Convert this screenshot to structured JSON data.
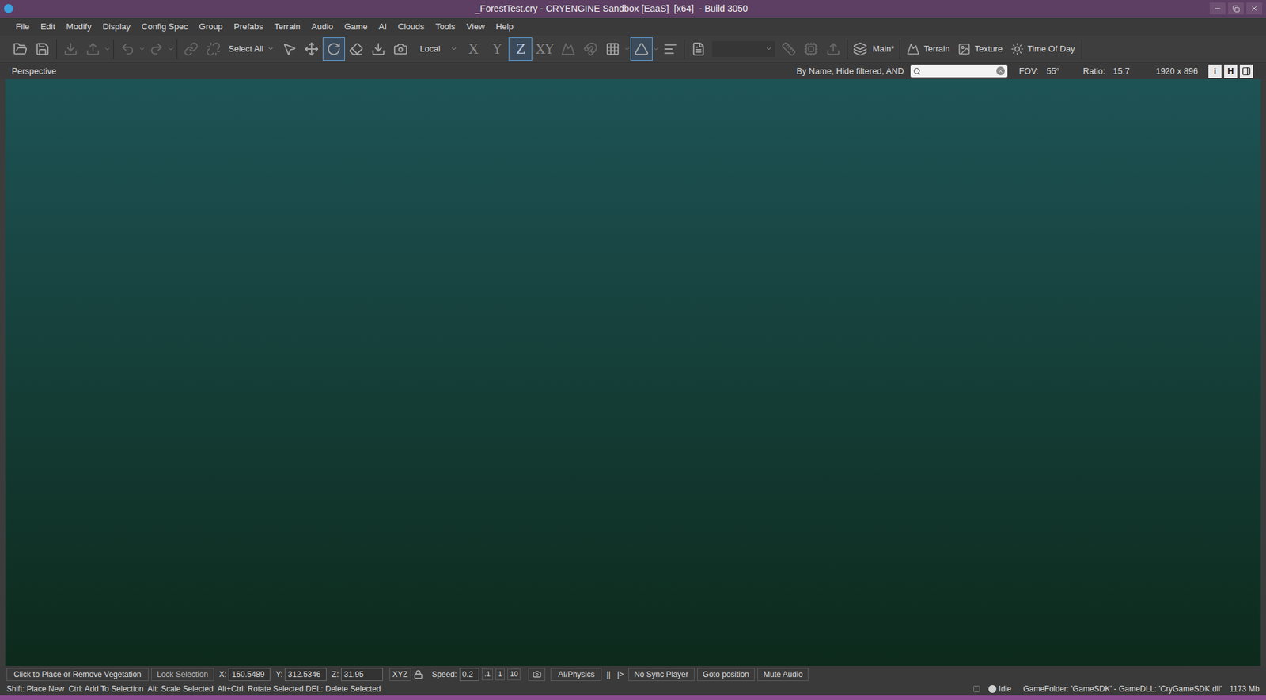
{
  "window": {
    "title": "_ForestTest.cry - CRYENGINE Sandbox [EaaS]  [x64]  - Build 3050"
  },
  "menu": [
    "File",
    "Edit",
    "Modify",
    "Display",
    "Config Spec",
    "Group",
    "Prefabs",
    "Terrain",
    "Audio",
    "Game",
    "AI",
    "Clouds",
    "Tools",
    "View",
    "Help"
  ],
  "toolbar": {
    "selection_filter": "Select All",
    "tools": [
      {
        "kind": "select",
        "selected": false
      },
      {
        "kind": "move",
        "selected": false
      },
      {
        "kind": "rotate",
        "selected": true
      },
      {
        "kind": "scale",
        "selected": false
      },
      {
        "kind": "drop",
        "selected": false
      },
      {
        "kind": "camera",
        "selected": false
      }
    ],
    "coord_system": "Local",
    "axes": [
      {
        "label": "X",
        "selected": false
      },
      {
        "label": "Y",
        "selected": false
      },
      {
        "label": "Z",
        "selected": true
      },
      {
        "label": "XY",
        "selected": false
      }
    ],
    "snap_grid": false,
    "snap_angle": true,
    "layer": "Main*",
    "buttons": [
      "Terrain",
      "Texture",
      "Time Of Day"
    ]
  },
  "viewport_header": {
    "view": "Perspective",
    "filter": "By Name, Hide filtered, AND",
    "search": {
      "placeholder": ""
    },
    "fov_label": "FOV:",
    "fov": "55°",
    "ratio_label": "Ratio:",
    "ratio": "15:7",
    "resolution": "1920 x 896",
    "buttons": [
      "i",
      "H"
    ]
  },
  "status_bar": {
    "hint": "Click to Place or Remove Vegetation",
    "lock": "Lock Selection",
    "coords": [
      {
        "label": "X:",
        "value": "160.5489"
      },
      {
        "label": "Y:",
        "value": "312.5346"
      },
      {
        "label": "Z:",
        "value": "31.95"
      }
    ],
    "axis_lock": "XYZ",
    "speed_label": "Speed:",
    "speed": "0.2",
    "speed_presets": [
      ".1",
      "1",
      "10"
    ],
    "ai_physics": "AI/Physics",
    "playback": [
      "||",
      "|>"
    ],
    "buttons": [
      "No Sync Player",
      "Goto position",
      "Mute Audio"
    ]
  },
  "info_bar": {
    "shortcuts": "Shift: Place New  Ctrl: Add To Selection  Alt: Scale Selected  Alt+Ctrl: Rotate Selected DEL: Delete Selected",
    "state": "Idle",
    "game_folder": "GameFolder: 'GameSDK' - GameDLL: 'CryGameSDK.dll'",
    "memory": "1173 Mb"
  }
}
